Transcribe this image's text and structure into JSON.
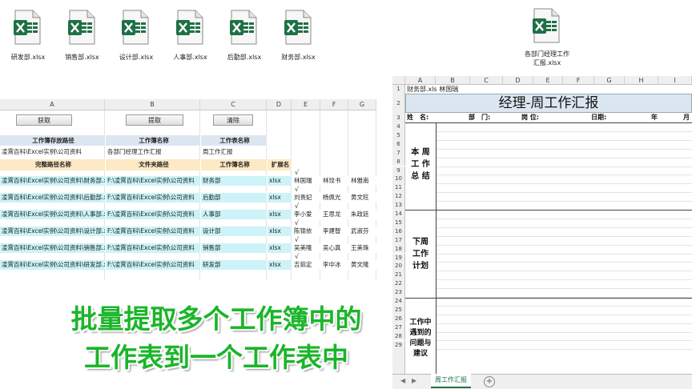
{
  "desktop_files": [
    {
      "name": "研发部.xlsx"
    },
    {
      "name": "销售部.xlsx"
    },
    {
      "name": "设计部.xlsx"
    },
    {
      "name": "人事部.xlsx"
    },
    {
      "name": "后勤部.xlsx"
    },
    {
      "name": "财务部.xlsx"
    }
  ],
  "template_file": {
    "line1": "各部门经理工作",
    "line2": "汇报.xlsx"
  },
  "left_sheet": {
    "columns": [
      "A",
      "B",
      "C",
      "D",
      "E",
      "F",
      "G"
    ],
    "buttons": {
      "get": "获取",
      "extract": "提取",
      "clear": "清除"
    },
    "header1": {
      "path": "工作簿存放路径",
      "book": "工作簿名称",
      "sheet": "工作表名称"
    },
    "config": {
      "path": "凌霄百科\\Excel实例\\公司资料",
      "book": "各部门经理工作汇报",
      "sheet": "周工作汇报"
    },
    "header2": {
      "full": "完整路径名称",
      "folder": "文件夹路径",
      "book": "工作簿名称",
      "ext": "扩展名"
    },
    "check_mark": "√",
    "rows": [
      {
        "full": "凌霄百科\\Excel实例\\公司资料\\财务部.xl",
        "folder": "F:\\凌霄百科\\Excel实例\\公司资料",
        "book": "财务部",
        "ext": "xlsx",
        "e": "林国瑞",
        "f": "林玟书",
        "g": "林雅南"
      },
      {
        "full": "凌霄百科\\Excel实例\\公司资料\\后勤部.xl",
        "folder": "F:\\凌霄百科\\Excel实例\\公司资料",
        "book": "后勤部",
        "ext": "xlsx",
        "e": "刘贵妃",
        "f": "杨佩光",
        "g": "黄文旺"
      },
      {
        "full": "凌霄百科\\Excel实例\\公司资料\\人事部.xl",
        "folder": "F:\\凌霄百科\\Excel实例\\公司资料",
        "book": "人事部",
        "ext": "xlsx",
        "e": "李小爱",
        "f": "王思龙",
        "g": "朱政廷"
      },
      {
        "full": "凌霄百科\\Excel实例\\公司资料\\设计部.xl",
        "folder": "F:\\凌霄百科\\Excel实例\\公司资料",
        "book": "设计部",
        "ext": "xlsx",
        "e": "陈锦依",
        "f": "李建智",
        "g": "武淑芬"
      },
      {
        "full": "凌霄百科\\Excel实例\\公司资料\\销售部.xl",
        "folder": "F:\\凌霄百科\\Excel实例\\公司资料",
        "book": "销售部",
        "ext": "xlsx",
        "e": "吴美隆",
        "f": "吴心真",
        "g": "王美珠"
      },
      {
        "full": "凌霄百科\\Excel实例\\公司资料\\研发部.xl",
        "folder": "F:\\凌霄百科\\Excel实例\\公司资料",
        "book": "研发部",
        "ext": "xlsx",
        "e": "吉茹定",
        "f": "李中冰",
        "g": "黄文隆"
      }
    ]
  },
  "right_sheet": {
    "columns": [
      "A",
      "B",
      "C",
      "D",
      "E",
      "F",
      "G",
      "H",
      "I"
    ],
    "row_numbers": [
      "1",
      "2",
      "3",
      "4",
      "5",
      "6",
      "7",
      "8",
      "9",
      "10",
      "11",
      "12",
      "13",
      "14",
      "15",
      "16",
      "17",
      "18",
      "19",
      "20",
      "21",
      "22",
      "23",
      "24",
      "25",
      "26",
      "27",
      "28",
      "29"
    ],
    "cell_a1": "财务部.xls 林国瑞",
    "title": "经理-周工作汇报",
    "info": {
      "name": "姓　名:",
      "dept": "部　门:",
      "post": "岗 位:",
      "date": "日期:",
      "year": "年",
      "month": "月"
    },
    "sections": {
      "summary": [
        "本 周",
        "工 作",
        "总 结"
      ],
      "plan": [
        "下周",
        "工作",
        "计划"
      ],
      "issues": [
        "工作中",
        "遇到的",
        "问题与",
        "建议"
      ]
    },
    "active_tab": "周工作汇报",
    "add_tab": "+"
  },
  "caption": {
    "line1": "批量提取多个工作簿中的",
    "line2": "工作表到一个工作表中"
  },
  "colors": {
    "excel_green": "#1e7145",
    "caption_green": "#1bb52a",
    "cyan_rows": "#ccf3f8",
    "header_blue": "#dce6f1",
    "ext_header": "#fde9c5"
  }
}
